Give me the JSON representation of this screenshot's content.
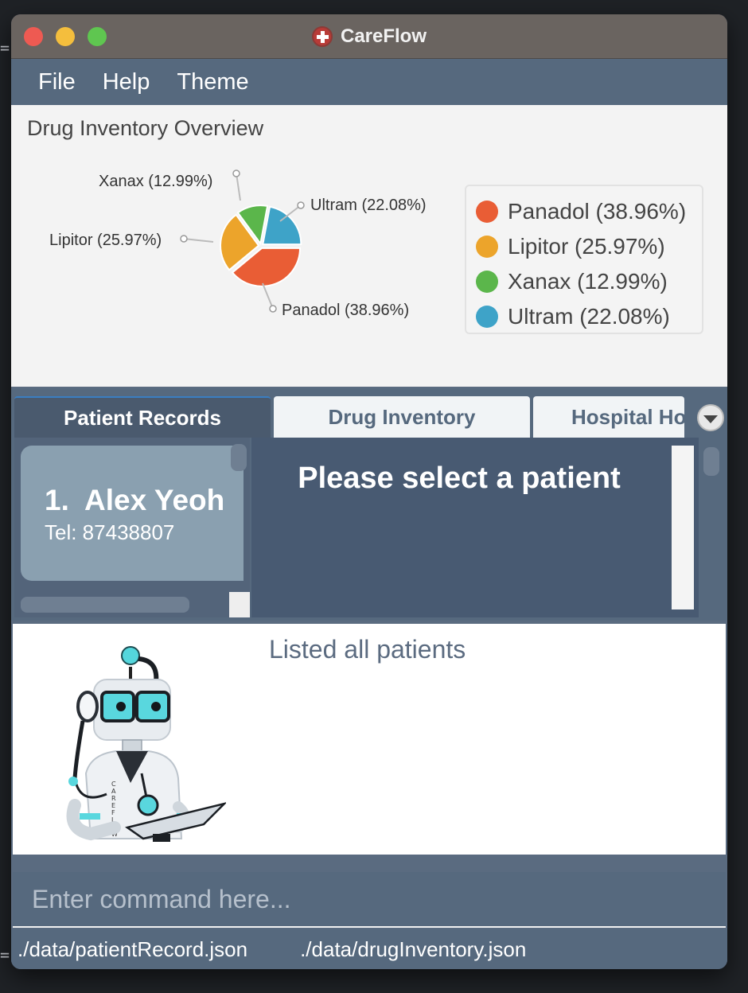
{
  "window": {
    "title": "CareFlow"
  },
  "menu": {
    "items": [
      "File",
      "Help",
      "Theme"
    ]
  },
  "overview": {
    "title": "Drug Inventory Overview",
    "slice_labels": {
      "panadol": "Panadol (38.96%)",
      "lipitor": "Lipitor (25.97%)",
      "xanax": "Xanax (12.99%)",
      "ultram": "Ultram (22.08%)"
    },
    "legend": [
      {
        "label": "Panadol (38.96%)",
        "color": "#e95d35"
      },
      {
        "label": "Lipitor (25.97%)",
        "color": "#eca42b"
      },
      {
        "label": "Xanax (12.99%)",
        "color": "#5bb64b"
      },
      {
        "label": "Ultram (22.08%)",
        "color": "#3ea3c8"
      }
    ]
  },
  "chart_data": {
    "type": "pie",
    "title": "Drug Inventory Overview",
    "categories": [
      "Panadol",
      "Lipitor",
      "Xanax",
      "Ultram"
    ],
    "values": [
      38.96,
      25.97,
      12.99,
      22.08
    ],
    "colors": [
      "#e95d35",
      "#eca42b",
      "#5bb64b",
      "#3ea3c8"
    ],
    "legend_position": "right"
  },
  "tabs": {
    "patient_records": "Patient Records",
    "drug_inventory": "Drug Inventory",
    "hospital": "Hospital Hours",
    "active": "Patient Records"
  },
  "patients": [
    {
      "index": "1.",
      "name": "Alex Yeoh",
      "tel": "Tel: 87438807"
    }
  ],
  "detail": {
    "placeholder": "Please select a patient"
  },
  "result": {
    "message": "Listed all patients",
    "mascot_text": "CAREFLOW"
  },
  "command": {
    "placeholder": "Enter command here..."
  },
  "status": {
    "patient_file": "./data/patientRecord.json",
    "drug_file": "./data/drugInventory.json"
  },
  "icons": {
    "app_logo": "medical-cross-icon",
    "tab_overflow": "chevron-down-icon"
  }
}
